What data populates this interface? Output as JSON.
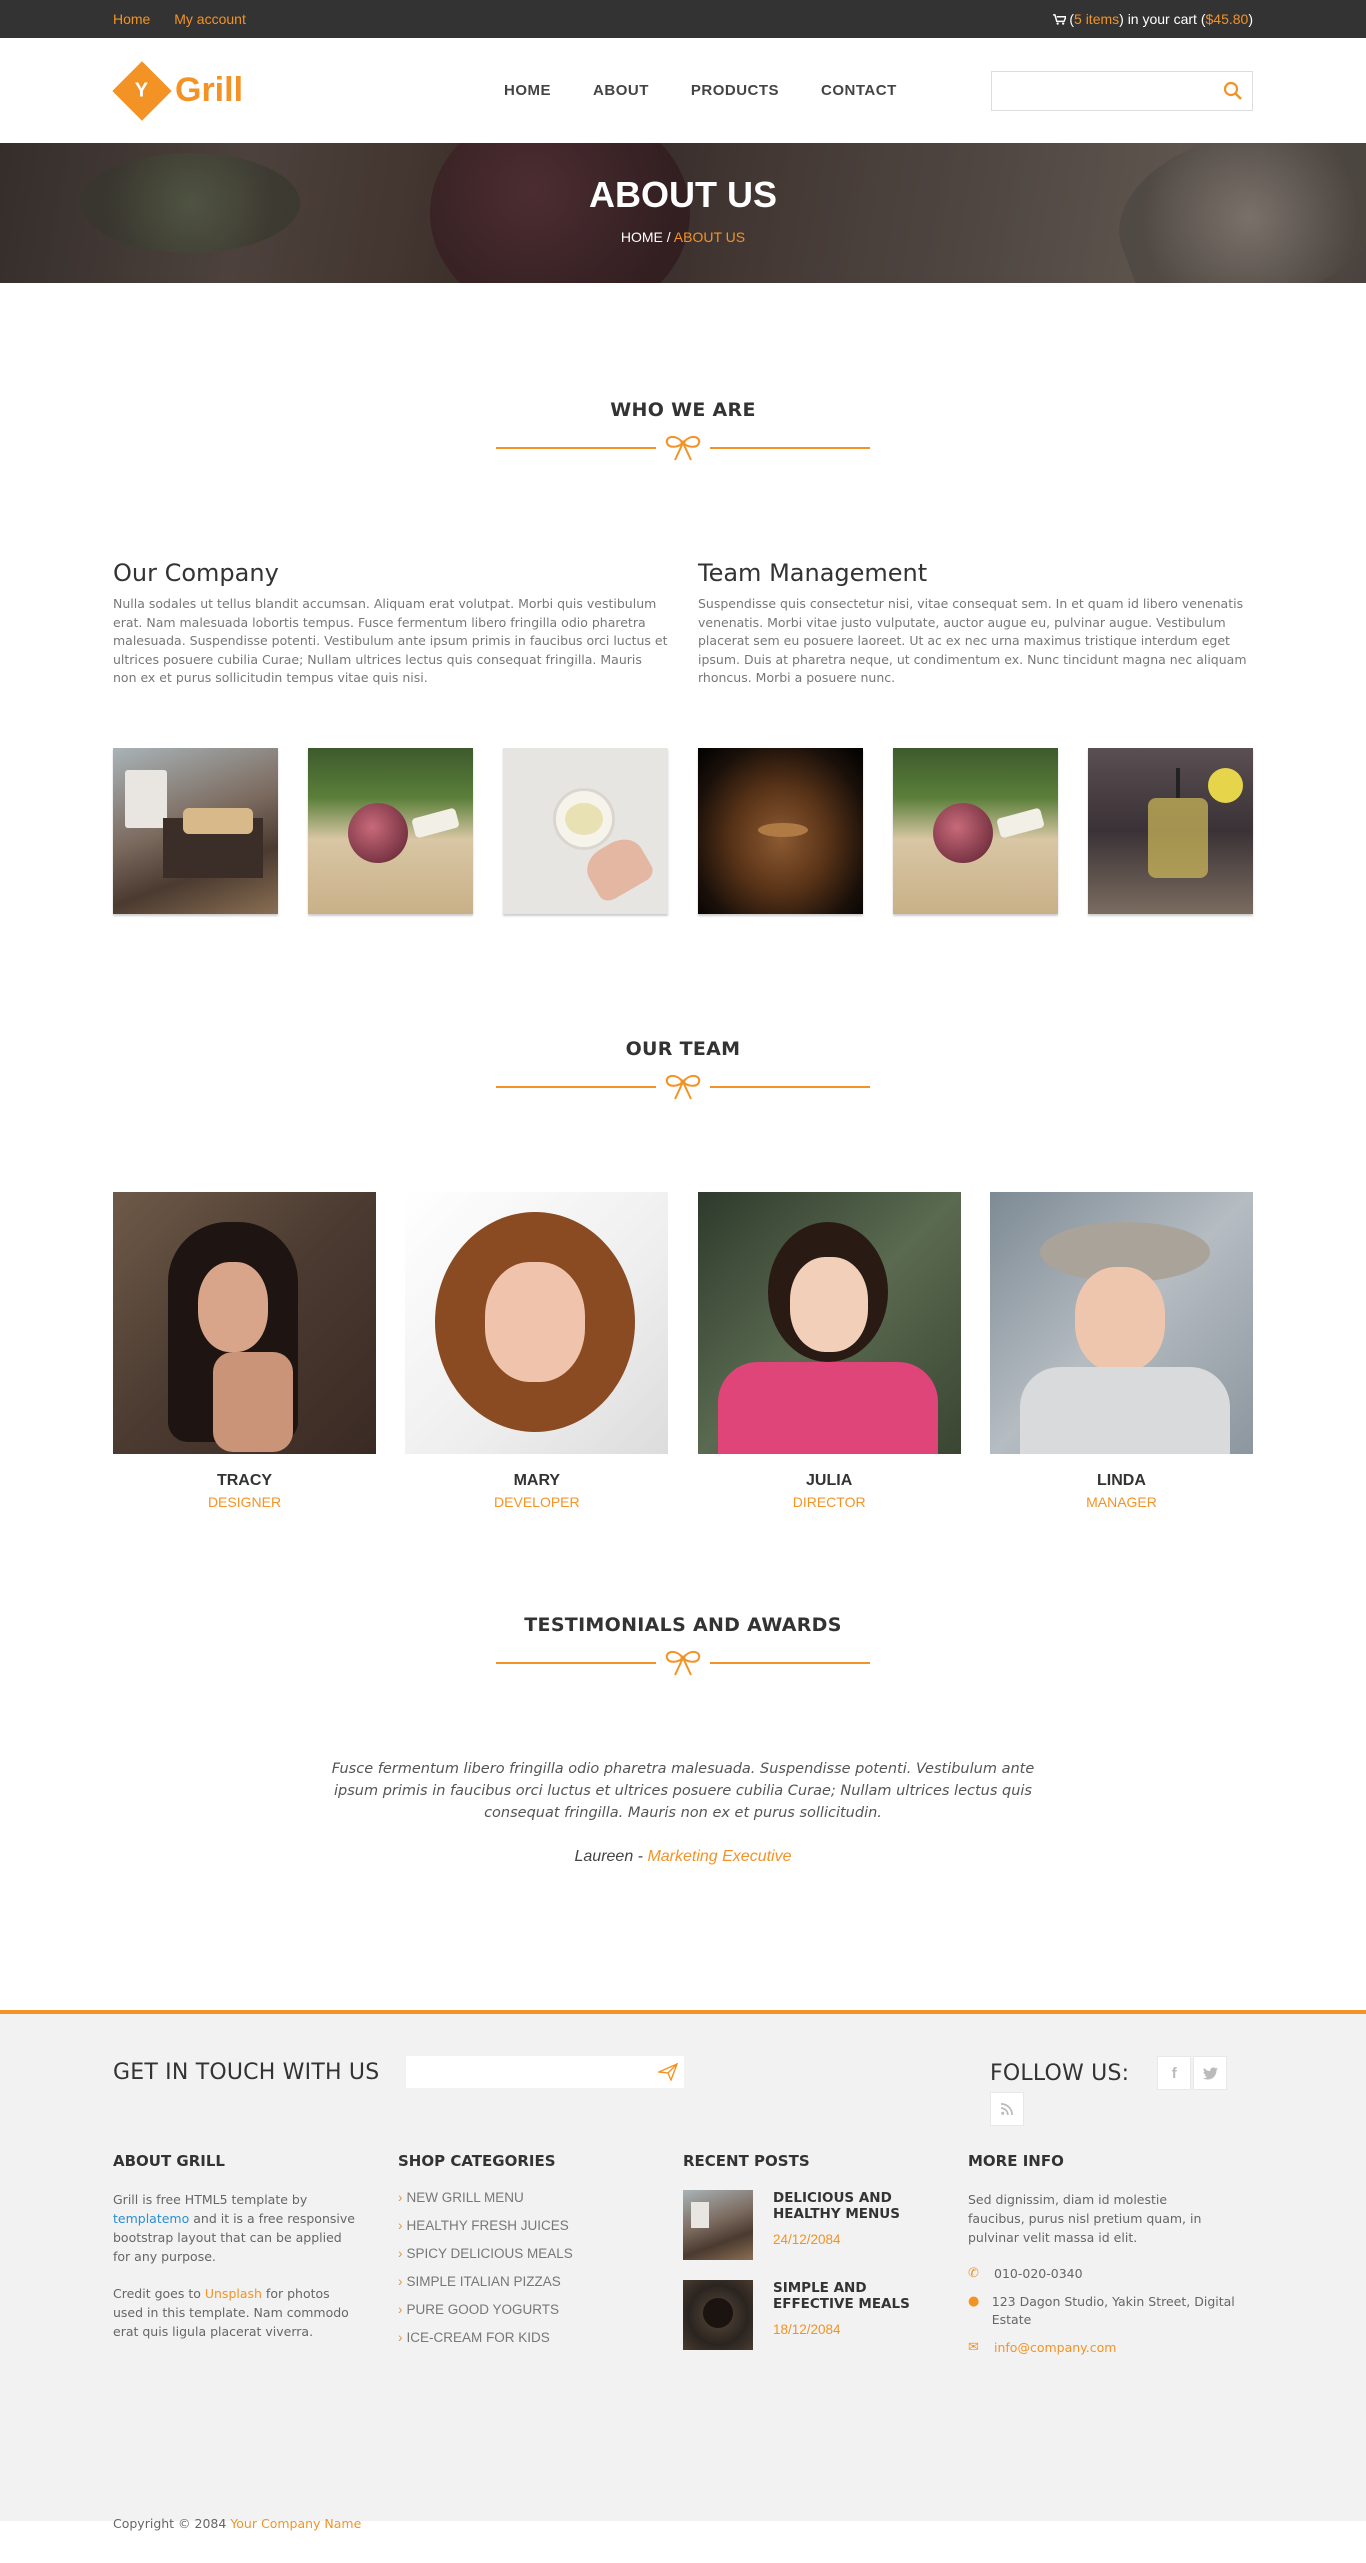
{
  "topbar": {
    "links": [
      "Home",
      "My account"
    ],
    "cart_prefix": "(",
    "cart_items": "5 items",
    "cart_mid": ") in your cart (",
    "cart_total": "$45.80",
    "cart_suffix": ")"
  },
  "header": {
    "logo_text": "Grill",
    "nav": [
      "HOME",
      "ABOUT",
      "PRODUCTS",
      "CONTACT"
    ],
    "search_placeholder": ""
  },
  "banner": {
    "title": "ABOUT US",
    "crumb_home": "HOME",
    "crumb_sep": " / ",
    "crumb_current": "ABOUT US"
  },
  "who": {
    "title": "WHO WE ARE",
    "columns": [
      {
        "heading": "Our Company",
        "text": "Nulla sodales ut tellus blandit accumsan. Aliquam erat volutpat. Morbi quis vestibulum erat. Nam malesuada lobortis tempus. Fusce fermentum libero fringilla odio pharetra malesuada. Suspendisse potenti. Vestibulum ante ipsum primis in faucibus orci luctus et ultrices posuere cubilia Curae; Nullam ultrices lectus quis consequat fringilla. Mauris non ex et purus sollicitudin tempus vitae quis nisi."
      },
      {
        "heading": "Team Management",
        "text": "Suspendisse quis consectetur nisi, vitae consequat sem. In et quam id libero venenatis venenatis. Morbi vitae justo vulputate, auctor augue eu, pulvinar augue. Vestibulum placerat sem eu posuere laoreet. Ut ac ex nec urna maximus tristique interdum eget ipsum. Duis at pharetra neque, ut condimentum ex. Nunc tincidunt magna nec aliquam rhoncus. Morbi a posuere nunc."
      }
    ]
  },
  "team": {
    "title": "OUR TEAM",
    "members": [
      {
        "name": "TRACY",
        "role": "DESIGNER"
      },
      {
        "name": "MARY",
        "role": "DEVELOPER"
      },
      {
        "name": "JULIA",
        "role": "DIRECTOR"
      },
      {
        "name": "LINDA",
        "role": "MANAGER"
      }
    ]
  },
  "testimonials": {
    "title": "TESTIMONIALS AND AWARDS",
    "quote": "Fusce fermentum libero fringilla odio pharetra malesuada. Suspendisse potenti. Vestibulum ante ipsum primis in faucibus orci luctus et ultrices posuere cubilia Curae; Nullam ultrices lectus quis consequat fringilla. Mauris non ex et purus sollicitudin.",
    "author": "Laureen",
    "author_sep": " - ",
    "author_role": "Marketing Executive"
  },
  "footer": {
    "contact_title": "GET IN TOUCH WITH US",
    "email_placeholder": "",
    "follow_title": "FOLLOW US:",
    "social": [
      "f",
      "t",
      "rss"
    ],
    "about": {
      "title": "ABOUT GRILL",
      "p1_a": "Grill is free HTML5 template by ",
      "p1_link": "templatemo",
      "p1_b": " and it is a free responsive bootstrap layout that can be applied for any purpose.",
      "p2_a": "Credit goes to ",
      "p2_link": "Unsplash",
      "p2_b": " for photos used in this template. Nam commodo erat quis ligula placerat viverra."
    },
    "categories": {
      "title": "SHOP CATEGORIES",
      "items": [
        "NEW GRILL MENU",
        "HEALTHY FRESH JUICES",
        "SPICY DELICIOUS MEALS",
        "SIMPLE ITALIAN PIZZAS",
        "PURE GOOD YOGURTS",
        "ICE-CREAM FOR KIDS"
      ]
    },
    "posts": {
      "title": "RECENT POSTS",
      "items": [
        {
          "title": "DELICIOUS AND HEALTHY MENUS",
          "date": "24/12/2084"
        },
        {
          "title": "SIMPLE AND EFFECTIVE MEALS",
          "date": "18/12/2084"
        }
      ]
    },
    "more": {
      "title": "MORE INFO",
      "text": "Sed dignissim, diam id molestie faucibus, purus nisl pretium quam, in pulvinar velit massa id elit.",
      "phone": "010-020-0340",
      "address": "123 Dagon Studio, Yakin Street, Digital Estate",
      "email": "info@company.com"
    },
    "copyright_prefix": "Copyright © 2084 ",
    "copyright_company": "Your Company Name"
  },
  "colors": {
    "accent": "#f39325",
    "topbar": "#333333",
    "footer_bg": "#f2f2f2",
    "link_blue": "#2a8fd0"
  },
  "icons": [
    "cart-icon",
    "search-icon",
    "bow-icon",
    "send-icon",
    "facebook-icon",
    "twitter-icon",
    "rss-icon",
    "phone-icon",
    "globe-icon",
    "envelope-icon",
    "chevron-right-icon"
  ]
}
